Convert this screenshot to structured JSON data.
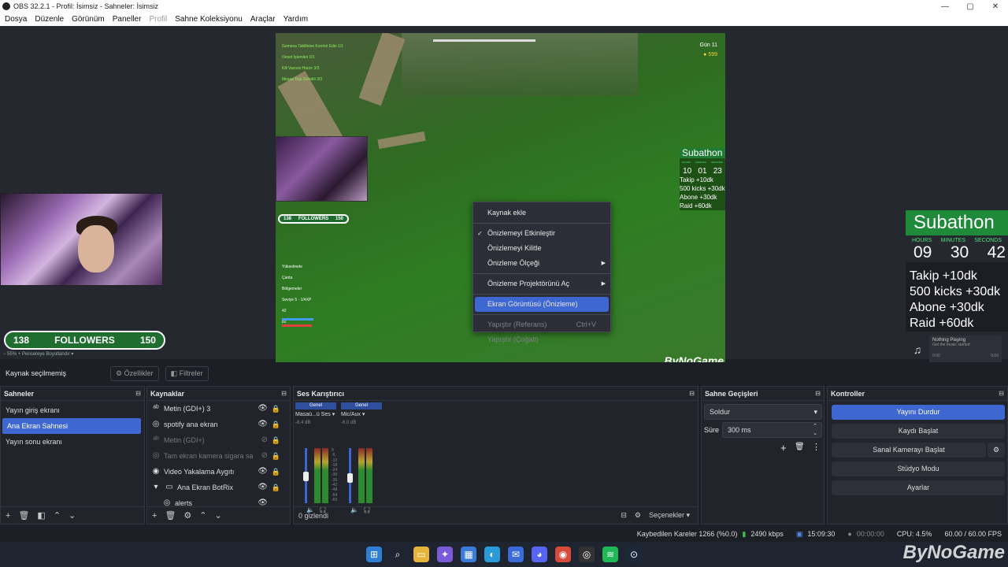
{
  "window": {
    "title": "OBS 32.2.1 - Profil: İsimsiz - Sahneler: İsimsiz"
  },
  "menu": [
    "Dosya",
    "Düzenle",
    "Görünüm",
    "Paneller",
    "Profil",
    "Sahne Koleksiyonu",
    "Araçlar",
    "Yardım"
  ],
  "preview": {
    "hud_quests": [
      "Gemeva Taklifeine Kontrol Edin 1/1",
      "Oeset İşlemleri 0/1",
      "Kill Vazoso Haızır 3/3",
      "Meşae Taşı Gerekli 3/3"
    ],
    "day": "Gün 11",
    "gold": "599",
    "mini_followers_left": "138",
    "mini_followers_label": "FOLLOWERS",
    "mini_followers_right": "150",
    "inventory": [
      "Yükselmekr",
      "Çanta",
      "Bölgemeler",
      "Seviye 5 · 1/4XP",
      "42",
      "82"
    ],
    "mini_subathon_title": "Subathon",
    "mini_subathon_units": [
      "HOURS",
      "MINUTES",
      "SECONDS"
    ],
    "mini_subathon_nums": [
      "10",
      "01",
      "23"
    ],
    "mini_subathon_perks": [
      "Takip +10dk",
      "500 kicks +30dk",
      "Abone +30dk",
      "Raid +60dk"
    ],
    "watermark": "ByNoGame",
    "followers_left": "138",
    "followers_label": "FOLLOWERS",
    "followers_right": "150",
    "zoom": "55%",
    "zoom_label": "Pencereye Boyutlandır",
    "subathon_title": "Subathon",
    "subathon_units": [
      "HOURS",
      "MINUTES",
      "SECONDS"
    ],
    "subathon_nums": [
      "09",
      "30",
      "42"
    ],
    "subathon_perks": [
      "Takip +10dk",
      "500 kicks +30dk",
      "Abone +30dk",
      "Raid +60dk"
    ],
    "spotify_title": "Nothing Playing",
    "spotify_sub": "Get the music started",
    "spotify_time_left": "0:00",
    "spotify_time_right": "0:00"
  },
  "context_menu": {
    "add_source": "Kaynak ekle",
    "enable_preview": "Önizlemeyi Etkinleştir",
    "lock_preview": "Önizlemeyi Kilitle",
    "preview_scale": "Önizleme Ölçeği",
    "open_projector": "Önizleme Projektörünü Aç",
    "screenshot": "Ekran Görüntüsü (Önizleme)",
    "paste_ref": "Yapıştır (Referans)",
    "paste_ref_shortcut": "Ctrl+V",
    "paste_dup": "Yapıştır (Çoğalt)"
  },
  "source_toolbar": {
    "no_selection": "Kaynak seçilmemiş",
    "properties": "Özellikler",
    "filters": "Filtreler"
  },
  "scenes": {
    "title": "Sahneler",
    "items": [
      "Yayın giriş ekranı",
      "Ana Ekran Sahnesi",
      "Yayın sonu ekranı"
    ],
    "active_index": 1
  },
  "sources": {
    "title": "Kaynaklar",
    "items": [
      {
        "label": "Metin (GDI+) 3",
        "icon": "text-icon"
      },
      {
        "label": "spotify ana ekran",
        "icon": "browser-icon"
      },
      {
        "label": "Metin (GDI+)",
        "icon": "text-icon"
      },
      {
        "label": "Tam ekran kamera sigara sa",
        "icon": "browser-icon"
      },
      {
        "label": "Video Yakalama Aygıtı",
        "icon": "camera-icon"
      },
      {
        "label": "Ana Ekran BotRix",
        "icon": "folder-icon"
      },
      {
        "label": "alerts",
        "icon": "browser-icon"
      }
    ]
  },
  "mixer": {
    "title": "Ses Karıştırıcı",
    "channels": [
      {
        "header": "Genel",
        "name": "Masaü...ü Ses",
        "db": "-8.4 dB"
      },
      {
        "header": "Genel",
        "name": "Mic/Aux",
        "db": "-6.0 dB"
      }
    ],
    "scale": [
      "0",
      "-6",
      "-12",
      "-18",
      "-24",
      "-30",
      "-36",
      "-42",
      "-48",
      "-54",
      "-60"
    ],
    "hidden": "0 gizlendi",
    "options": "Seçenekler"
  },
  "transitions": {
    "title": "Sahne Geçişleri",
    "type": "Soldur",
    "duration_label": "Süre",
    "duration": "300 ms"
  },
  "controls": {
    "title": "Kontroller",
    "buttons": [
      "Yayını Durdur",
      "Kaydı Başlat",
      "Sanal Kamerayı Başlat",
      "Stüdyo Modu",
      "Ayarlar"
    ]
  },
  "status": {
    "dropped": "Kaybedilen Kareler 1266 (%0.0)",
    "bitrate": "2490 kbps",
    "stream_time": "15:09:30",
    "rec_time": "00:00:00",
    "cpu": "CPU: 4.5%",
    "fps": "60.00 / 60.00 FPS"
  },
  "taskbar_watermark": "ByNoGame",
  "colors": {
    "accent": "#3f67d1",
    "bg": "#1d1f26",
    "panel": "#22242c"
  }
}
